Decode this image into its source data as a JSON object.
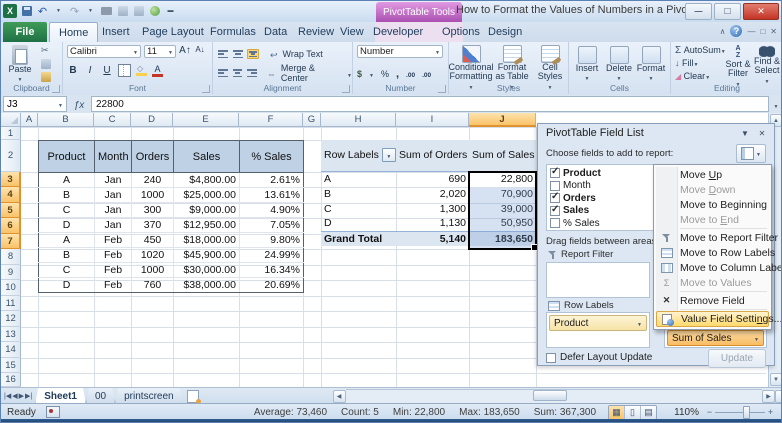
{
  "window": {
    "title": "How to Format the Values of Numbers in a Pivot ...",
    "contextual_group": "PivotTable Tools"
  },
  "ribbon": {
    "tabs": [
      "File",
      "Home",
      "Insert",
      "Page Layout",
      "Formulas",
      "Data",
      "Review",
      "View",
      "Developer"
    ],
    "contextual_tabs": [
      "Options",
      "Design"
    ],
    "active_tab": "Home",
    "clipboard": {
      "paste": "Paste",
      "label": "Clipboard"
    },
    "font": {
      "name": "Calibri",
      "size": "11",
      "label": "Font"
    },
    "alignment": {
      "wrap": "Wrap Text",
      "merge": "Merge & Center",
      "label": "Alignment"
    },
    "number": {
      "format": "Number",
      "label": "Number"
    },
    "styles": {
      "conditional": "Conditional Formatting",
      "format_table": "Format as Table",
      "cell_styles": "Cell Styles",
      "label": "Styles"
    },
    "cells": {
      "insert": "Insert",
      "delete": "Delete",
      "format": "Format",
      "label": "Cells"
    },
    "editing": {
      "autosum": "AutoSum",
      "fill": "Fill",
      "clear": "Clear",
      "sort": "Sort & Filter",
      "find": "Find & Select",
      "label": "Editing"
    }
  },
  "formula_bar": {
    "name_box": "J3",
    "value": "22800"
  },
  "sheet": {
    "column_letters": [
      "A",
      "B",
      "C",
      "D",
      "E",
      "F",
      "G",
      "H",
      "I",
      "J"
    ],
    "selected_column": "J",
    "row_count": 16,
    "selected_rows": [
      3,
      4,
      5,
      6,
      7
    ]
  },
  "data_table": {
    "headers": [
      "Product",
      "Month",
      "Orders",
      "Sales",
      "% Sales"
    ],
    "rows": [
      [
        "A",
        "Jan",
        "240",
        "$4,800.00",
        "2.61%"
      ],
      [
        "B",
        "Jan",
        "1000",
        "$25,000.00",
        "13.61%"
      ],
      [
        "C",
        "Jan",
        "300",
        "$9,000.00",
        "4.90%"
      ],
      [
        "D",
        "Jan",
        "370",
        "$12,950.00",
        "7.05%"
      ],
      [
        "A",
        "Feb",
        "450",
        "$18,000.00",
        "9.80%"
      ],
      [
        "B",
        "Feb",
        "1020",
        "$45,900.00",
        "24.99%"
      ],
      [
        "C",
        "Feb",
        "1000",
        "$30,000.00",
        "16.34%"
      ],
      [
        "D",
        "Feb",
        "760",
        "$38,000.00",
        "20.69%"
      ]
    ]
  },
  "pivot_table": {
    "headers": [
      "Row Labels",
      "Sum of Orders",
      "Sum of Sales"
    ],
    "rows": [
      [
        "A",
        "690",
        "22,800"
      ],
      [
        "B",
        "2,020",
        "70,900"
      ],
      [
        "C",
        "1,300",
        "39,000"
      ],
      [
        "D",
        "1,130",
        "50,950"
      ]
    ],
    "grand_total": [
      "Grand Total",
      "5,140",
      "183,650"
    ]
  },
  "field_list": {
    "title": "PivotTable Field List",
    "choose_label": "Choose fields to add to report:",
    "fields": [
      {
        "label": "Product",
        "checked": true
      },
      {
        "label": "Month",
        "checked": false
      },
      {
        "label": "Orders",
        "checked": true
      },
      {
        "label": "Sales",
        "checked": true
      },
      {
        "label": "% Sales",
        "checked": false
      }
    ],
    "drag_label": "Drag fields between areas below:",
    "report_filter_label": "Report Filter",
    "row_labels_label": "Row Labels",
    "row_field": "Product",
    "value_field": "Sum of Sales",
    "defer_label": "Defer Layout Update",
    "update_label": "Update"
  },
  "context_menu": {
    "items": [
      {
        "pre": "Move ",
        "key": "U",
        "post": "p",
        "enabled": true,
        "highlighted": false,
        "icon": ""
      },
      {
        "pre": "Move ",
        "key": "D",
        "post": "own",
        "enabled": false,
        "highlighted": false,
        "icon": ""
      },
      {
        "pre": "Move to Be",
        "key": "g",
        "post": "inning",
        "enabled": true,
        "highlighted": false,
        "icon": ""
      },
      {
        "pre": "Move to ",
        "key": "E",
        "post": "nd",
        "enabled": false,
        "highlighted": false,
        "icon": ""
      },
      {
        "pre": "Move to Report Filter",
        "key": "",
        "post": "",
        "enabled": true,
        "highlighted": false,
        "icon": "filter"
      },
      {
        "pre": "Move to Row Labels",
        "key": "",
        "post": "",
        "enabled": true,
        "highlighted": false,
        "icon": "table-rows"
      },
      {
        "pre": "Move to Column Labels",
        "key": "",
        "post": "",
        "enabled": true,
        "highlighted": false,
        "icon": "table-columns"
      },
      {
        "pre": "Move to Values",
        "key": "",
        "post": "",
        "enabled": false,
        "highlighted": false,
        "icon": "sigma"
      },
      {
        "pre": "Remove Field",
        "key": "",
        "post": "",
        "enabled": true,
        "highlighted": false,
        "icon": "remove-x"
      },
      {
        "pre": "Value Field Setti",
        "key": "n",
        "post": "gs...",
        "enabled": true,
        "highlighted": true,
        "icon": "value-field-settings"
      }
    ]
  },
  "sheet_tabs": {
    "tabs": [
      "Sheet1",
      "00",
      "printscreen"
    ],
    "active": "Sheet1"
  },
  "status_bar": {
    "mode": "Ready",
    "average": "Average: 73,460",
    "count": "Count: 5",
    "min": "Min: 22,800",
    "max": "Max: 183,650",
    "sum": "Sum: 367,300",
    "zoom": "110%"
  }
}
